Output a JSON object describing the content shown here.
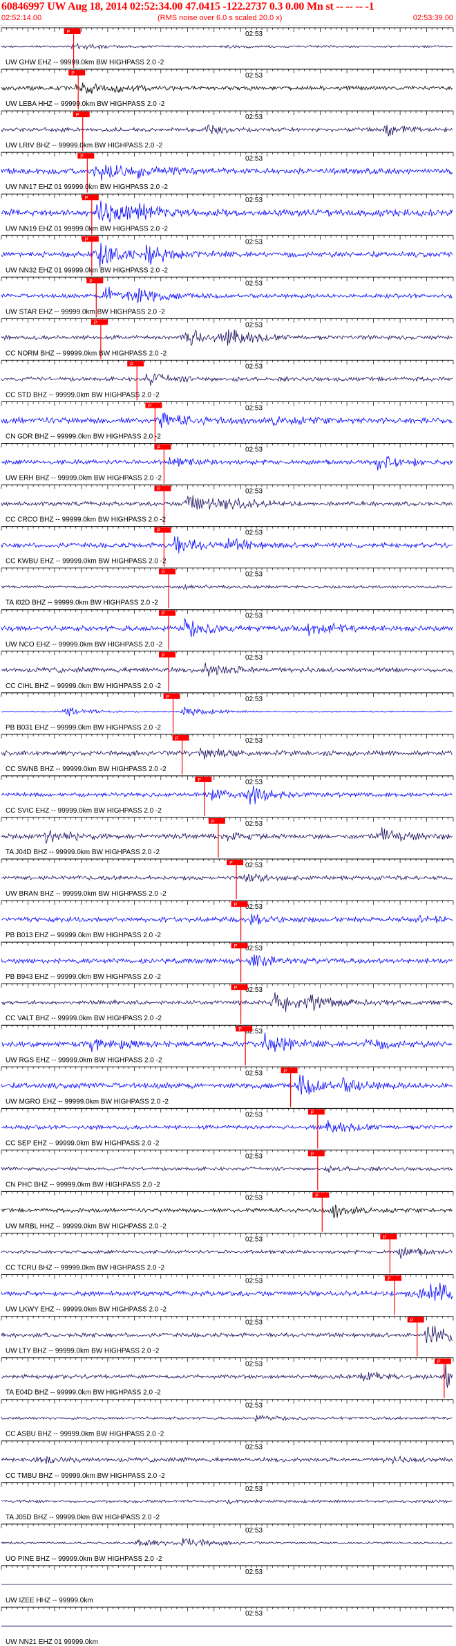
{
  "header": {
    "title": "60846997 UW Aug 18, 2014 02:52:34.00   47.0415 -122.2737  0.3 0.00 Mn st -- -- --  -1",
    "start_time": "02:52:14.00",
    "rms_note": "(RMS noise over 6.0 s scaled 20.0 x)",
    "end_time": "02:53:39.00"
  },
  "colors": {
    "alternating_trace_colors": [
      "#1a0a5a",
      "#0000ff"
    ],
    "pick_color": "#ff0000",
    "label_color": "#000000",
    "background": "#ffffff"
  },
  "chart_data": {
    "type": "line",
    "title": "60846997 UW Aug 18, 2014 02:52:34.00",
    "time_window": [
      "02:52:14.00",
      "02:53:39.00"
    ],
    "minute_mark_label": "02:53",
    "pick_label": "P",
    "traces": [
      {
        "label": "UW GHW EHZ -- 99999.0km BW  HIGHPASS  2.0 -2",
        "pick_x": 0.16,
        "color": "#1a0a5a",
        "events": [
          [
            0.16,
            0.6
          ],
          [
            0.5,
            0.15
          ]
        ],
        "noise": 0.15
      },
      {
        "label": "UW LEBA HHZ -- 99999.0km BW  HIGHPASS  2.0 -2",
        "pick_x": 0.17,
        "color": "#000000",
        "events": [
          [
            0.17,
            0.9
          ],
          [
            0.25,
            0.4
          ]
        ],
        "noise": 0.3
      },
      {
        "label": "UW LRIV BHZ -- 99999.0km BW  HIGHPASS  2.0 -2",
        "pick_x": 0.18,
        "color": "#1a0a5a",
        "events": [
          [
            0.45,
            0.5
          ],
          [
            0.85,
            0.8
          ]
        ],
        "noise": 0.3
      },
      {
        "label": "UW NN17 EHZ 01 99999.0km BW  HIGHPASS  2.0 -2",
        "pick_x": 0.19,
        "color": "#0000ff",
        "events": [
          [
            0.21,
            1.3
          ],
          [
            0.3,
            0.6
          ]
        ],
        "noise": 0.4
      },
      {
        "label": "UW NN19 EHZ 01 99999.0km BW  HIGHPASS  2.0 -2",
        "pick_x": 0.2,
        "color": "#0000ff",
        "events": [
          [
            0.21,
            2.0
          ],
          [
            0.3,
            0.8
          ]
        ],
        "noise": 0.5
      },
      {
        "label": "UW NN32 EHZ 01 99999.0km BW  HIGHPASS  2.0 -2",
        "pick_x": 0.2,
        "color": "#0000ff",
        "events": [
          [
            0.21,
            2.2
          ],
          [
            0.32,
            1.2
          ]
        ],
        "noise": 0.4
      },
      {
        "label": "UW STAR EHZ -- 99999.0km BW  HIGHPASS  2.0 -2",
        "pick_x": 0.21,
        "color": "#0000ff",
        "events": [
          [
            0.23,
            1.6
          ],
          [
            0.3,
            0.7
          ]
        ],
        "noise": 0.3
      },
      {
        "label": "CC NORM BHZ -- 99999.0km BW  HIGHPASS  2.0 -2",
        "pick_x": 0.22,
        "color": "#1a0a5a",
        "events": [
          [
            0.4,
            1.6
          ],
          [
            0.5,
            1.0
          ]
        ],
        "noise": 0.3
      },
      {
        "label": "CC STD BHZ -- 99999.0km BW  HIGHPASS  2.0 -2",
        "pick_x": 0.3,
        "color": "#1a0a5a",
        "events": [
          [
            0.32,
            0.8
          ]
        ],
        "noise": 0.3
      },
      {
        "label": "CN GDR BHZ -- 99999.0km BW  HIGHPASS  2.0 -2",
        "pick_x": 0.34,
        "color": "#0000ff",
        "events": [
          [
            0.35,
            0.9
          ],
          [
            0.6,
            0.5
          ]
        ],
        "noise": 0.45
      },
      {
        "label": "UW ERH BHZ -- 99999.0km BW  HIGHPASS  2.0 -2",
        "pick_x": 0.36,
        "color": "#0000ff",
        "events": [
          [
            0.83,
            1.2
          ],
          [
            0.37,
            0.5
          ]
        ],
        "noise": 0.35
      },
      {
        "label": "CC CRCO BHZ -- 99999.0km BW  HIGHPASS  2.0 -2",
        "pick_x": 0.36,
        "color": "#1a0a5a",
        "events": [
          [
            0.41,
            1.6
          ],
          [
            0.5,
            0.8
          ]
        ],
        "noise": 0.3
      },
      {
        "label": "CC KWBU EHZ -- 99999.0km BW  HIGHPASS  2.0 -2",
        "pick_x": 0.36,
        "color": "#0000ff",
        "events": [
          [
            0.38,
            1.3
          ],
          [
            0.5,
            0.7
          ]
        ],
        "noise": 0.35
      },
      {
        "label": "TA I02D BHZ -- 99999.0km BW  HIGHPASS  2.0 -2",
        "pick_x": 0.37,
        "color": "#1a0a5a",
        "events": [
          [
            0.4,
            0.3
          ]
        ],
        "noise": 0.2
      },
      {
        "label": "UW NCO EHZ -- 99999.0km BW  HIGHPASS  2.0 -2",
        "pick_x": 0.37,
        "color": "#0000ff",
        "events": [
          [
            0.4,
            1.4
          ],
          [
            0.68,
            0.9
          ]
        ],
        "noise": 0.4
      },
      {
        "label": "CC CIHL BHZ -- 99999.0km BW  HIGHPASS  2.0 -2",
        "pick_x": 0.37,
        "color": "#1a0a5a",
        "events": [
          [
            0.45,
            0.8
          ]
        ],
        "noise": 0.35
      },
      {
        "label": "PB B031 EHZ -- 99999.0km BW  HIGHPASS  2.0 -2",
        "pick_x": 0.38,
        "color": "#0000ff",
        "events": [
          [
            0.14,
            0.7
          ],
          [
            0.4,
            0.9
          ]
        ],
        "noise": 0.1
      },
      {
        "label": "CC SWNB BHZ -- 99999.0km BW  HIGHPASS  2.0 -2",
        "pick_x": 0.4,
        "color": "#1a0a5a",
        "events": [
          [
            0.44,
            0.7
          ]
        ],
        "noise": 0.35
      },
      {
        "label": "CC SVIC EHZ -- 99999.0km BW  HIGHPASS  2.0 -2",
        "pick_x": 0.45,
        "color": "#0000ff",
        "events": [
          [
            0.54,
            1.4
          ],
          [
            0.46,
            0.8
          ]
        ],
        "noise": 0.3
      },
      {
        "label": "TA J04D BHZ -- 99999.0km BW  HIGHPASS  2.0 -2",
        "pick_x": 0.48,
        "color": "#1a0a5a",
        "events": [
          [
            0.09,
            1.1
          ],
          [
            0.83,
            1.2
          ],
          [
            0.5,
            0.6
          ]
        ],
        "noise": 0.35
      },
      {
        "label": "UW BRAN BHZ -- 99999.0km BW  HIGHPASS  2.0 -2",
        "pick_x": 0.52,
        "color": "#1a0a5a",
        "events": [
          [
            0.54,
            0.5
          ]
        ],
        "noise": 0.3
      },
      {
        "label": "PB B013 EHZ -- 99999.0km BW  HIGHPASS  2.0 -2",
        "pick_x": 0.53,
        "color": "#0000ff",
        "events": [
          [
            0.55,
            0.7
          ],
          [
            0.92,
            0.4
          ]
        ],
        "noise": 0.35
      },
      {
        "label": "PB B943 EHZ -- 99999.0km BW  HIGHPASS  2.0 -2",
        "pick_x": 0.53,
        "color": "#0000ff",
        "events": [
          [
            0.55,
            0.8
          ]
        ],
        "noise": 0.35
      },
      {
        "label": "CC VALT BHZ -- 99999.0km BW  HIGHPASS  2.0 -2",
        "pick_x": 0.53,
        "color": "#1a0a5a",
        "events": [
          [
            0.6,
            1.8
          ],
          [
            0.68,
            0.8
          ]
        ],
        "noise": 0.3
      },
      {
        "label": "UW RGS EHZ -- 99999.0km BW  HIGHPASS  2.0 -2",
        "pick_x": 0.54,
        "color": "#0000ff",
        "events": [
          [
            0.2,
            1.0
          ],
          [
            0.58,
            1.4
          ],
          [
            0.8,
            0.8
          ]
        ],
        "noise": 0.4
      },
      {
        "label": "UW MGRO EHZ -- 99999.0km BW  HIGHPASS  2.0 -2",
        "pick_x": 0.64,
        "color": "#0000ff",
        "events": [
          [
            0.66,
            1.4
          ],
          [
            0.75,
            0.7
          ]
        ],
        "noise": 0.4
      },
      {
        "label": "CC SEP EHZ -- 99999.0km BW  HIGHPASS  2.0 -2",
        "pick_x": 0.7,
        "color": "#0000ff",
        "events": [
          [
            0.72,
            0.8
          ]
        ],
        "noise": 0.3
      },
      {
        "label": "CN PHC BHZ -- 99999.0km BW  HIGHPASS  2.0 -2",
        "pick_x": 0.7,
        "color": "#1a0a5a",
        "events": [
          [
            0.72,
            0.3
          ]
        ],
        "noise": 0.25
      },
      {
        "label": "UW MRBL HHZ -- 99999.0km BW  HIGHPASS  2.0 -2",
        "pick_x": 0.71,
        "color": "#000000",
        "events": [
          [
            0.73,
            0.9
          ]
        ],
        "noise": 0.3
      },
      {
        "label": "CC TCRU BHZ -- 99999.0km BW  HIGHPASS  2.0 -2",
        "pick_x": 0.86,
        "color": "#1a0a5a",
        "events": [
          [
            0.88,
            0.8
          ]
        ],
        "noise": 0.25
      },
      {
        "label": "UW LKWY EHZ -- 99999.0km BW  HIGHPASS  2.0 -2",
        "pick_x": 0.87,
        "color": "#0000ff",
        "events": [
          [
            0.9,
            0.9
          ],
          [
            0.95,
            1.4
          ]
        ],
        "noise": 0.35
      },
      {
        "label": "UW LTY BHZ -- 99999.0km BW  HIGHPASS  2.0 -2",
        "pick_x": 0.92,
        "color": "#1a0a5a",
        "events": [
          [
            0.94,
            1.6
          ]
        ],
        "noise": 0.3
      },
      {
        "label": "TA E04D BHZ -- 99999.0km BW  HIGHPASS  2.0 -2",
        "pick_x": 0.98,
        "color": "#1a0a5a",
        "events": [
          [
            0.8,
            0.7
          ],
          [
            0.98,
            1.8
          ]
        ],
        "noise": 0.3
      },
      {
        "label": "CC ASBU BHZ -- 99999.0km BW  HIGHPASS  2.0 -2",
        "pick_x": null,
        "color": "#1a0a5a",
        "events": [
          [
            0.56,
            0.4
          ]
        ],
        "noise": 0.2
      },
      {
        "label": "CC TMBU BHZ -- 99999.0km BW  HIGHPASS  2.0 -2",
        "pick_x": null,
        "color": "#1a0a5a",
        "events": [
          [
            0.08,
            0.5
          ],
          [
            0.85,
            0.4
          ]
        ],
        "noise": 0.3
      },
      {
        "label": "TA J05D BHZ -- 99999.0km BW  HIGHPASS  2.0 -2",
        "pick_x": null,
        "color": "#1a0a5a",
        "events": [
          [
            0.5,
            0.2
          ]
        ],
        "noise": 0.2
      },
      {
        "label": "UO PINE BHZ -- 99999.0km BW  HIGHPASS  2.0 -2",
        "pick_x": null,
        "color": "#1a0a5a",
        "events": [
          [
            0.4,
            0.9
          ],
          [
            0.3,
            0.6
          ]
        ],
        "noise": 0.15
      },
      {
        "label": "UW IZEE HHZ -- 99999.0km",
        "pick_x": null,
        "color": "#1a0a5a",
        "events": [],
        "noise": 0.0
      },
      {
        "label": "UW NN21 EHZ 01 99999.0km",
        "pick_x": null,
        "color": "#1a0a5a",
        "events": [],
        "noise": 0.0
      }
    ]
  }
}
